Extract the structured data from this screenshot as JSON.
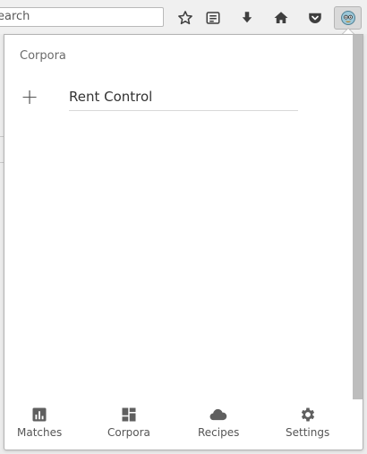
{
  "toolbar": {
    "search_value": "earch",
    "buttons": [
      {
        "name": "bookmark-star-icon"
      },
      {
        "name": "reading-list-icon"
      },
      {
        "name": "download-icon"
      },
      {
        "name": "home-icon"
      },
      {
        "name": "pocket-icon"
      },
      {
        "name": "extension-icon"
      }
    ]
  },
  "panel": {
    "title": "Corpora",
    "corpus_input_value": "Rent Control",
    "add_symbol": "+"
  },
  "tabs": [
    {
      "label": "Matches",
      "icon": "bar-chart-icon"
    },
    {
      "label": "Corpora",
      "icon": "dashboard-icon"
    },
    {
      "label": "Recipes",
      "icon": "cloud-icon"
    },
    {
      "label": "Settings",
      "icon": "gear-icon"
    }
  ],
  "colors": {
    "icon": "#4a4a4a",
    "tab_icon": "#5f5f5f",
    "scrollbar": "#bdbdbd"
  }
}
